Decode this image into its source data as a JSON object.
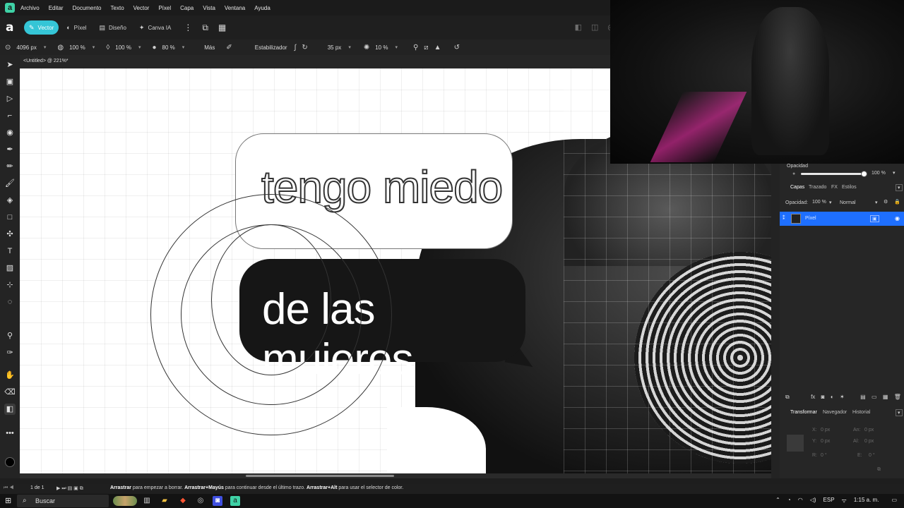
{
  "menu": {
    "items": [
      "Archivo",
      "Editar",
      "Documento",
      "Texto",
      "Vector",
      "Píxel",
      "Capa",
      "Vista",
      "Ventana",
      "Ayuda"
    ]
  },
  "personas": [
    {
      "label": "Vector",
      "icon": "vector-pen-icon",
      "active": true
    },
    {
      "label": "Píxel",
      "icon": "pixel-brush-icon",
      "active": false
    },
    {
      "label": "Diseño",
      "icon": "layout-icon",
      "active": false
    },
    {
      "label": "Canva IA",
      "icon": "sparkle-icon",
      "active": false
    }
  ],
  "context": {
    "size": "4096 px",
    "opacity1": "100 %",
    "flow": "100 %",
    "hardness": "80 %",
    "more": "Más",
    "stabilizer": "Estabilizador",
    "rope": "35 px",
    "spacing": "10 %"
  },
  "document": {
    "tab": "<Untitled> @ 221%*"
  },
  "canvas": {
    "bubble_top": "tengo miedo",
    "bubble_bottom": "de las mujeres"
  },
  "panel": {
    "opacity_label": "Opacidad",
    "opacity_value": "100 %",
    "tabs": [
      "Capas",
      "Trazado",
      "FX",
      "Estilos"
    ],
    "layer_opacity_label": "Opacidad:",
    "layer_opacity_value": "100 %",
    "blend_mode": "Normal",
    "layer_name": "Píxel",
    "bottom_tabs": [
      "Transformar",
      "Navegador",
      "Historial"
    ],
    "transform": {
      "x_label": "X:",
      "x": "0 px",
      "y_label": "Y:",
      "y": "0 px",
      "r_label": "R:",
      "r": "0 °",
      "an_label": "An:",
      "an": "0 px",
      "al_label": "Al:",
      "al": "0 px",
      "e_label": "E:",
      "e": "0 °"
    }
  },
  "status": {
    "page": "1 de 1",
    "hint_b1": "Arrastrar",
    "hint_t1": " para empezar a borrar. ",
    "hint_b2": "Arrastrar+Mayús",
    "hint_t2": " para continuar desde el último trazo. ",
    "hint_b3": "Arrastrar+Alt",
    "hint_t3": " para usar el selector de color."
  },
  "taskbar": {
    "search": "Buscar",
    "lang": "ESP",
    "time": "1:15 a. m."
  },
  "colors": {
    "accent": "#35c5d6",
    "selection": "#1e6fff",
    "app_logo": "#3fd2a6"
  }
}
